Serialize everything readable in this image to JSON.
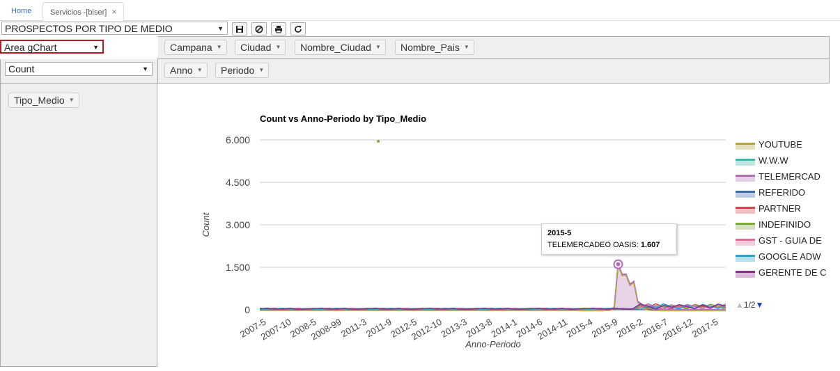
{
  "tabs": {
    "home": "Home",
    "active": "Servicios -[biser]",
    "close": "×"
  },
  "toolbar": {
    "report": "PROSPECTOS POR TIPO DE MEDIO",
    "buttons": [
      "save-icon",
      "clear-icon",
      "print-icon",
      "refresh-icon"
    ]
  },
  "left": {
    "chart_type": "Area gChart",
    "measure": "Count",
    "row_fields": [
      "Tipo_Medio"
    ]
  },
  "pivot": {
    "column_fields": [
      "Campana",
      "Ciudad",
      "Nombre_Ciudad",
      "Nombre_Pais"
    ],
    "row_fields": [
      "Anno",
      "Periodo"
    ]
  },
  "tooltip": {
    "title": "2015-5",
    "series": "TELEMERCADEO OASIS:",
    "value": "1.607"
  },
  "pager": "1/2",
  "colors": {
    "accent_border": "#b01e24",
    "link": "#3a74b3"
  },
  "chart_data": {
    "type": "area",
    "title": "Count vs Anno-Periodo by Tipo_Medio",
    "xlabel": "Anno-Periodo",
    "ylabel": "Count",
    "ylim": [
      0,
      6000
    ],
    "yticks": [
      "0",
      "1.500",
      "3.000",
      "4.500",
      "6.000"
    ],
    "xticks": [
      "2007-5",
      "2007-10",
      "2008-5",
      "2008-99",
      "2011-3",
      "2011-9",
      "2012-5",
      "2012-10",
      "2013-3",
      "2013-8",
      "2014-1",
      "2014-6",
      "2014-11",
      "2015-4",
      "2015-9",
      "2016-2",
      "2016-7",
      "2016-12",
      "2017-5"
    ],
    "grid": true,
    "legend_position": "right",
    "series": [
      {
        "name": "YOUTUBE",
        "color": "#b5a33b"
      },
      {
        "name": "W.W.W",
        "color": "#3cb5a9"
      },
      {
        "name": "TELEMERCAD",
        "color": "#b06fb7",
        "values": [
          20,
          20,
          15,
          20,
          10,
          10,
          10,
          10,
          10,
          10,
          10,
          20,
          30,
          80,
          1607,
          1250,
          1260,
          900,
          1000,
          300,
          200,
          50,
          30,
          20,
          20,
          10,
          10,
          10,
          10
        ]
      },
      {
        "name": "REFERIDO",
        "color": "#3d6aa8"
      },
      {
        "name": "PARTNER",
        "color": "#d6434a"
      },
      {
        "name": "INDEFINIDO",
        "color": "#7dab3a",
        "outlier": {
          "x": "2008-99",
          "y": 5950
        }
      },
      {
        "name": "GST - GUIA DE",
        "color": "#e0679a"
      },
      {
        "name": "GOOGLE ADW",
        "color": "#26a3cf"
      },
      {
        "name": "GERENTE DE C",
        "color": "#8e2b8e"
      }
    ]
  }
}
